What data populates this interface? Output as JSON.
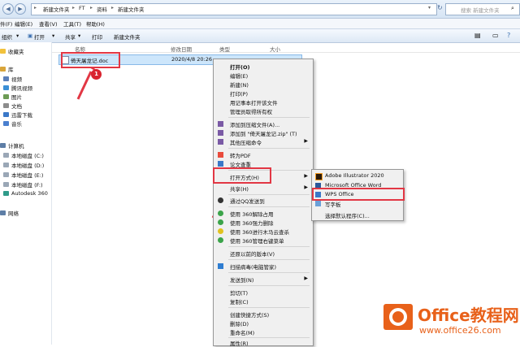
{
  "address": {
    "crumbs": [
      "新建文件夹",
      "FT",
      "资料",
      "新建文件夹"
    ],
    "search_placeholder": "搜索 新建文件夹"
  },
  "menubar": [
    "件(F)",
    "编辑(E)",
    "查看(V)",
    "工具(T)",
    "帮助(H)"
  ],
  "toolbar": {
    "organize": "组织",
    "open": "打开",
    "share": "共享",
    "print": "打印",
    "new_folder": "新建文件夹"
  },
  "nav": {
    "favorites": "收藏夹",
    "library": "库",
    "library_items": [
      "视频",
      "腾讯视频",
      "图片",
      "文档",
      "迅雷下载",
      "音乐"
    ],
    "computer": "计算机",
    "drives": [
      "本地磁盘 (C:)",
      "本地磁盘 (D:)",
      "本地磁盘 (E:)",
      "本地磁盘 (F:)",
      "Autodesk 360"
    ],
    "network": "网络"
  },
  "columns": {
    "name": "名称",
    "modified": "修改日期",
    "type": "类型",
    "size": "大小"
  },
  "file": {
    "name": "倚天屠龙记.doc",
    "modified": "2020/4/8 20:26"
  },
  "badges": [
    "1",
    "2",
    "3"
  ],
  "context_menu": {
    "g1": [
      "打开(O)",
      "编辑(E)",
      "新建(N)",
      "打印(P)",
      "用记事本打开该文件",
      "管理员取得所有权"
    ],
    "g2": [
      "添加到压缩文件(A)...",
      "添加到 \"倚天屠龙记.zip\" (T)",
      "其他压缩命令"
    ],
    "g3": [
      "转为PDF",
      "论文查重"
    ],
    "open_with": "打开方式(H)",
    "g4b": [
      "共享(H)"
    ],
    "g5": [
      "通过QQ发送到"
    ],
    "g6": [
      "使用 360解除占用",
      "使用 360强力删除",
      "使用 360进行木马云查杀",
      "使用 360管理右键菜单"
    ],
    "g7": [
      "还原以前的版本(V)"
    ],
    "g8": [
      "扫描病毒(电脑管家)"
    ],
    "g9": [
      "发送到(N)"
    ],
    "g10": [
      "剪切(T)",
      "复制(C)"
    ],
    "g11": [
      "创建快捷方式(S)",
      "删除(D)",
      "重命名(M)"
    ],
    "g12": [
      "属性(R)"
    ]
  },
  "submenu": [
    "Adobe Illustrator 2020",
    "Microsoft Office Word",
    "WPS Office",
    "写字板",
    "选择默认程序(C)..."
  ],
  "watermark": {
    "title": "Office教程网",
    "url": "www.office26.com"
  },
  "colors": {
    "highlight_red": "#e23744",
    "selection_blue": "#cde6fb",
    "brand_orange": "#e8611a"
  }
}
